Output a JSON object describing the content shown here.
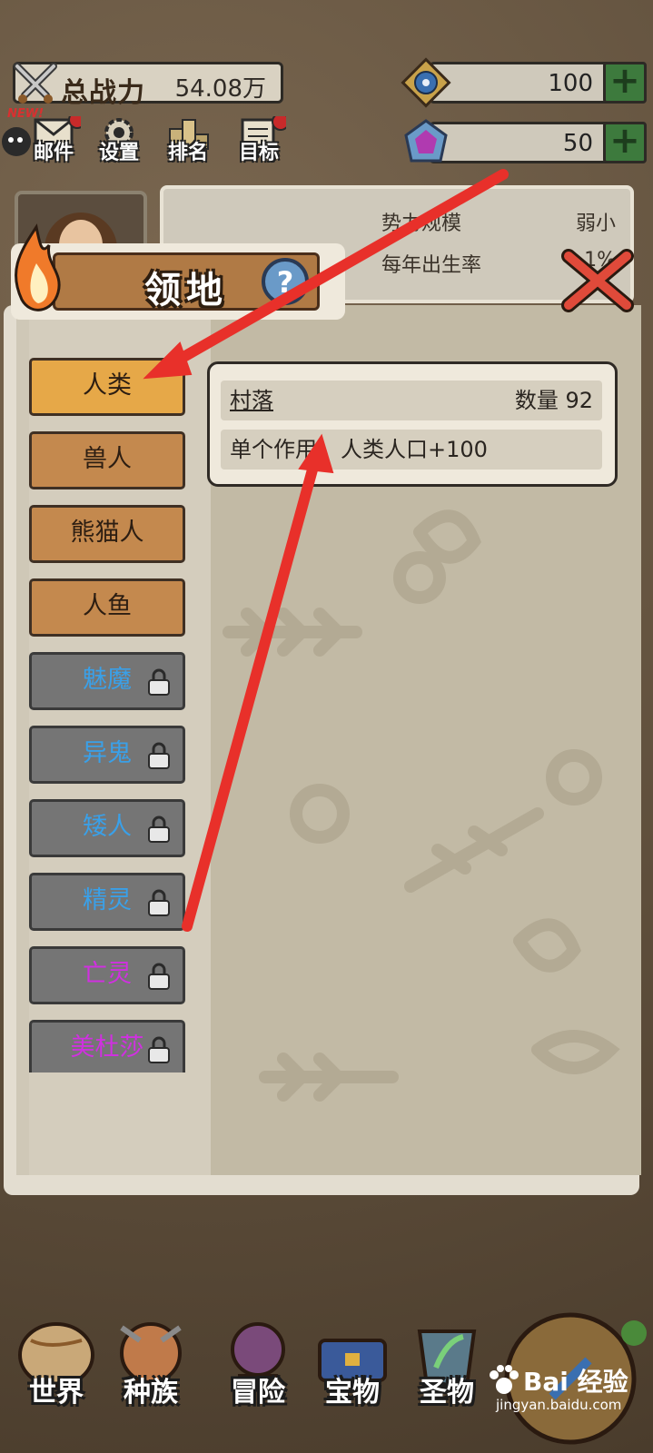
{
  "header": {
    "power_label": "总战力",
    "power_value": "54.08万",
    "resource1_value": "100",
    "resource2_value": "50",
    "plus_symbol": "+"
  },
  "menu": {
    "new_badge": "NEW!",
    "items": [
      {
        "label": "邮件"
      },
      {
        "label": "设置"
      },
      {
        "label": "排名"
      },
      {
        "label": "目标"
      }
    ]
  },
  "info": {
    "rows": [
      {
        "label": "势力规模",
        "value": "弱小"
      },
      {
        "label": "每年出生率",
        "value": "1%"
      }
    ]
  },
  "territory": {
    "title": "领地",
    "races": [
      {
        "label": "人类",
        "color": "#2d1e12",
        "state": "active"
      },
      {
        "label": "兽人",
        "color": "#2d1e12",
        "state": "unlocked"
      },
      {
        "label": "熊猫人",
        "color": "#2d1e12",
        "state": "unlocked"
      },
      {
        "label": "人鱼",
        "color": "#2d1e12",
        "state": "unlocked"
      },
      {
        "label": "魅魔",
        "color": "#3aa0e8",
        "state": "locked"
      },
      {
        "label": "异鬼",
        "color": "#3aa0e8",
        "state": "locked"
      },
      {
        "label": "矮人",
        "color": "#3aa0e8",
        "state": "locked"
      },
      {
        "label": "精灵",
        "color": "#3aa0e8",
        "state": "locked"
      },
      {
        "label": "亡灵",
        "color": "#d030e0",
        "state": "locked"
      },
      {
        "label": "美杜莎",
        "color": "#d030e0",
        "state": "locked"
      }
    ],
    "detail": {
      "building_name": "村落",
      "count_label": "数量 92",
      "effect_label": "单个作用：",
      "effect_value": "人类人口+100"
    }
  },
  "bottom_nav": {
    "items": [
      {
        "label": "世界"
      },
      {
        "label": "种族"
      },
      {
        "label": "冒险"
      },
      {
        "label": "宝物"
      },
      {
        "label": "圣物"
      }
    ]
  },
  "watermark": {
    "text": "Bai 经验",
    "url": "jingyan.baidu.com"
  },
  "colors": {
    "accent_arrow": "#e8302a",
    "wood": "#c4894e",
    "stone": "#757575",
    "plus_green": "#3d7a3d"
  }
}
